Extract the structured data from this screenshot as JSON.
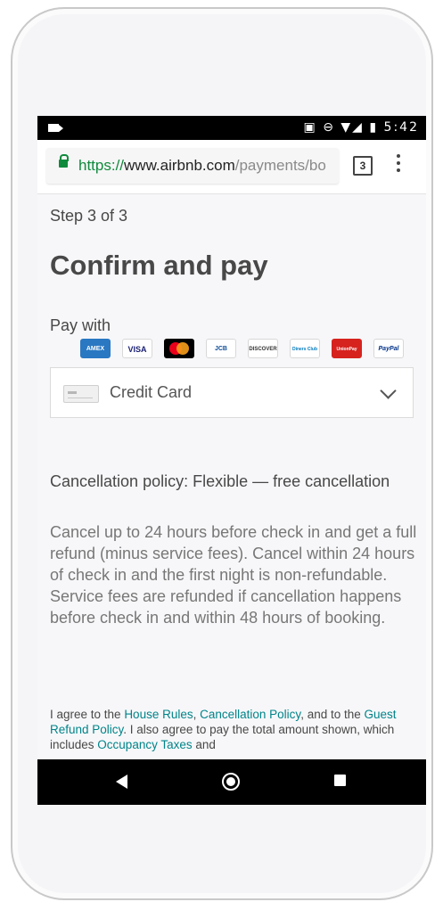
{
  "status_bar": {
    "time": "5:42",
    "icons": "▣ ⊖ ▼◢ ▮"
  },
  "browser": {
    "url_scheme": "https://",
    "url_host": "www.airbnb.com",
    "url_path": "/payments/bo",
    "tab_count": "3"
  },
  "page": {
    "step": "Step 3 of 3",
    "title": "Confirm and pay",
    "pay_with_label": "Pay with",
    "payment_icons": [
      "AMEX",
      "VISA",
      "Mastercard",
      "JCB",
      "DISCOVER",
      "Diners Club",
      "UnionPay",
      "PayPal"
    ],
    "payment_method": {
      "selected": "Credit Card"
    },
    "cancellation": {
      "heading": "Cancellation policy: Flexible — free cancellation",
      "body": "Cancel up to 24 hours before check in and get a full refund (minus service fees). Cancel within 24 hours of check in and the first night is non-refundable. Service fees are refunded if cancellation happens before check in and within 48 hours of booking."
    },
    "agreement": {
      "t1": "I agree to the ",
      "house_rules": "House Rules",
      "t2": ", ",
      "cancellation_policy": "Cancellation Policy",
      "t3": ", and to the ",
      "guest_refund_policy": "Guest Refund Policy",
      "t4": ". I also agree to pay the total amount shown, which includes ",
      "occupancy_taxes": "Occupancy Taxes",
      "t5": " and"
    }
  },
  "colors": {
    "link": "#008489",
    "secure_green": "#0f8a3c"
  }
}
